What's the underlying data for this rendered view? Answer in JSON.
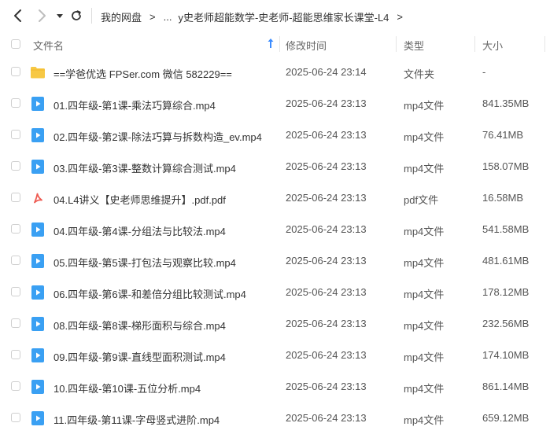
{
  "breadcrumb": {
    "root": "我的网盘",
    "ellipsis": "...",
    "current": "y史老师超能数学-史老师-超能思维家长课堂-L4"
  },
  "columns": {
    "name": "文件名",
    "modified": "修改时间",
    "type": "类型",
    "size": "大小"
  },
  "sort": {
    "column": "name",
    "direction": "ascending"
  },
  "colors": {
    "folder": "#f7c844",
    "video": "#3aa0f3",
    "pdf": "#ee5b52",
    "sort_arrow": "#3b8cff"
  },
  "files": [
    {
      "icon": "folder-icon",
      "name": "==学爸优选 FPSer.com 微信 582229==",
      "modified": "2025-06-24 23:14",
      "type": "文件夹",
      "size": "-"
    },
    {
      "icon": "video-file-icon",
      "name": "01.四年级-第1课-乘法巧算综合.mp4",
      "modified": "2025-06-24 23:13",
      "type": "mp4文件",
      "size": "841.35MB"
    },
    {
      "icon": "video-file-icon",
      "name": "02.四年级-第2课-除法巧算与拆数构造_ev.mp4",
      "modified": "2025-06-24 23:13",
      "type": "mp4文件",
      "size": "76.41MB"
    },
    {
      "icon": "video-file-icon",
      "name": "03.四年级-第3课-整数计算综合测试.mp4",
      "modified": "2025-06-24 23:13",
      "type": "mp4文件",
      "size": "158.07MB"
    },
    {
      "icon": "pdf-file-icon",
      "name": "04.L4讲义【史老师思维提升】.pdf.pdf",
      "modified": "2025-06-24 23:13",
      "type": "pdf文件",
      "size": "16.58MB"
    },
    {
      "icon": "video-file-icon",
      "name": "04.四年级-第4课-分组法与比较法.mp4",
      "modified": "2025-06-24 23:13",
      "type": "mp4文件",
      "size": "541.58MB"
    },
    {
      "icon": "video-file-icon",
      "name": "05.四年级-第5课-打包法与观察比较.mp4",
      "modified": "2025-06-24 23:13",
      "type": "mp4文件",
      "size": "481.61MB"
    },
    {
      "icon": "video-file-icon",
      "name": "06.四年级-第6课-和差倍分组比较测试.mp4",
      "modified": "2025-06-24 23:13",
      "type": "mp4文件",
      "size": "178.12MB"
    },
    {
      "icon": "video-file-icon",
      "name": "08.四年级-第8课-梯形面积与综合.mp4",
      "modified": "2025-06-24 23:13",
      "type": "mp4文件",
      "size": "232.56MB"
    },
    {
      "icon": "video-file-icon",
      "name": "09.四年级-第9课-直线型面积测试.mp4",
      "modified": "2025-06-24 23:13",
      "type": "mp4文件",
      "size": "174.10MB"
    },
    {
      "icon": "video-file-icon",
      "name": "10.四年级-第10课-五位分析.mp4",
      "modified": "2025-06-24 23:13",
      "type": "mp4文件",
      "size": "861.14MB"
    },
    {
      "icon": "video-file-icon",
      "name": "11.四年级-第11课-字母竖式进阶.mp4",
      "modified": "2025-06-24 23:13",
      "type": "mp4文件",
      "size": "659.12MB"
    }
  ]
}
